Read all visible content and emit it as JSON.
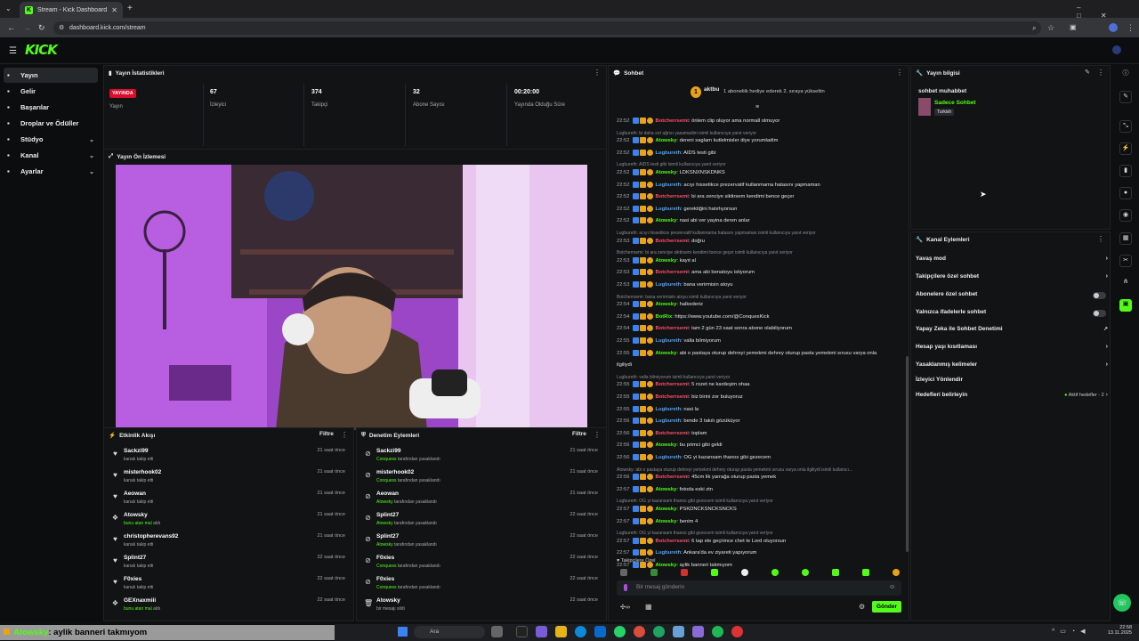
{
  "browser": {
    "tab_title": "Stream - Kick Dashboard",
    "url": "dashboard.kick.com/stream"
  },
  "header": {
    "logo": "KICK"
  },
  "nav": {
    "items": [
      {
        "label": "Yayın",
        "active": true
      },
      {
        "label": "Gelir"
      },
      {
        "label": "Başarılar"
      },
      {
        "label": "Droplar ve Ödüller"
      },
      {
        "label": "Stüdyo",
        "chevron": true
      },
      {
        "label": "Kanal",
        "chevron": true
      },
      {
        "label": "Ayarlar",
        "chevron": true
      }
    ]
  },
  "stats": {
    "title": "Yayın İstatistikleri",
    "live_badge": "YAYINDA",
    "live_label": "Yayın",
    "items": [
      {
        "value": "67",
        "label": "İzleyici"
      },
      {
        "value": "374",
        "label": "Takipçi"
      },
      {
        "value": "32",
        "label": "Abone Sayısı"
      },
      {
        "value": "00:20:00",
        "label": "Yayında Olduğu Süre"
      }
    ]
  },
  "preview": {
    "title": "Yayın Ön İzlemesi"
  },
  "activity": {
    "title": "Etkinlik Akışı",
    "filter": "Filtre",
    "rows": [
      {
        "icon": "heart",
        "name": "Sackzi99",
        "sub": "kanalı takip etti",
        "time": "21 saat önce"
      },
      {
        "icon": "heart",
        "name": "misterhook02",
        "sub": "kanalı takip etti",
        "time": "21 saat önce"
      },
      {
        "icon": "heart",
        "name": "Aeowan",
        "sub": "kanalı takip etti",
        "time": "21 saat önce"
      },
      {
        "icon": "gift",
        "name": "Atowsky",
        "sub_hl": "bunu atan mal",
        "sub": " aldı",
        "time": "21 saat önce"
      },
      {
        "icon": "heart",
        "name": "christopherevans92",
        "sub": "kanalı takip etti",
        "time": "21 saat önce"
      },
      {
        "icon": "heart",
        "name": "Splint27",
        "sub": "kanalı takip etti",
        "time": "22 saat önce"
      },
      {
        "icon": "heart",
        "name": "F0xies",
        "sub": "kanalı takip etti",
        "time": "22 saat önce"
      },
      {
        "icon": "gift",
        "name": "GEXnaxmiii",
        "sub_hl": "bunu atan mal",
        "sub": " aldı",
        "time": "22 saat önce"
      }
    ]
  },
  "moderation": {
    "title": "Denetim Eylemleri",
    "filter": "Filtre",
    "rows": [
      {
        "icon": "ban",
        "name": "Sackzi99",
        "sub_hl": "Conquess",
        "sub": " tarafından yasaklandı",
        "time": "21 saat önce"
      },
      {
        "icon": "ban",
        "name": "misterhook02",
        "sub_hl": "Conquess",
        "sub": " tarafından yasaklandı",
        "time": "21 saat önce"
      },
      {
        "icon": "ban",
        "name": "Aeowan",
        "sub_hl": "Atowsky",
        "sub": " tarafından yasaklandı",
        "time": "21 saat önce"
      },
      {
        "icon": "ban",
        "name": "Splint27",
        "sub_hl": "Atowsky",
        "sub": " tarafından yasaklandı",
        "time": "22 saat önce"
      },
      {
        "icon": "ban",
        "name": "Splint27",
        "sub_hl": "Atowsky",
        "sub": " tarafından yasaklandı",
        "time": "22 saat önce"
      },
      {
        "icon": "ban",
        "name": "F0xies",
        "sub_hl": "Conquess",
        "sub": " tarafından yasaklandı",
        "time": "22 saat önce"
      },
      {
        "icon": "ban",
        "name": "F0xies",
        "sub_hl": "Conquess",
        "sub": " tarafından yasaklandı",
        "time": "22 saat önce"
      },
      {
        "icon": "trash",
        "name": "Atowsky",
        "sub": "bir mesajı sildi",
        "time": "22 saat önce"
      }
    ]
  },
  "chat": {
    "title": "Sohbet",
    "pinned_user": "aktbu",
    "pinned_text": "1 aboneliik hediye ederek 2. sıraya yükseltin",
    "lines": [
      {
        "t": "22:52",
        "u": "Botcherrsemi",
        "c": "#ff4d6d",
        "m": ": önlem clip oluyor ama normall olmuyor"
      },
      {
        "reply": "Lugbureth: bi daha sırt ağrısı yasamadim isimli kullanıcıya yanıt veriyor"
      },
      {
        "t": "22:52",
        "u": "Atowsky",
        "c": "#53fc18",
        "m": ": dereni saglam kutlelmisler diye yorumladim"
      },
      {
        "t": "22:52",
        "u": "Lugbureth",
        "c": "#4da3ff",
        "m": ": AIDS testi gibi"
      },
      {
        "reply": "Lugbureth: AIDS testi gibi isimli kullanıcıya yanıt veriyor"
      },
      {
        "t": "22:52",
        "u": "Atowsky",
        "c": "#53fc18",
        "m": ": LDKSNXNSKDNKS"
      },
      {
        "t": "22:52",
        "u": "Lugbureth",
        "c": "#4da3ff",
        "m": ": acıyı hissetikce prezervatif kullanmama hatasını yapmaman"
      },
      {
        "t": "22:52",
        "u": "Botcherrsemi",
        "c": "#ff4d6d",
        "m": ": bi ara zenciye siktirsem kendimi bence geçer"
      },
      {
        "t": "22:52",
        "u": "Lugbureth",
        "c": "#4da3ff",
        "m": ": gerektiğini hatırlıyorsun"
      },
      {
        "t": "22:52",
        "u": "Atowsky",
        "c": "#53fc18",
        "m": ": nasi abi ver yayina deren anlar"
      },
      {
        "reply": "Lugbureth: acıyı hissetikce prezervatif kullanmama hatasını yapmaman isimli kullanıcıya yanıt veriyor"
      },
      {
        "t": "22:53",
        "u": "Botcherrsemi",
        "c": "#ff4d6d",
        "m": ": doğru"
      },
      {
        "reply": "Botcherrsemi: bi ara zenciye siktirsem kendimi bence geçer isimli kullanıcıya yanıt veriyor"
      },
      {
        "t": "22:53",
        "u": "Atowsky",
        "c": "#53fc18",
        "m": ": kayıt al"
      },
      {
        "t": "22:53",
        "u": "Botcherrsemi",
        "c": "#ff4d6d",
        "m": ": ama abi benatoyu istiyorum"
      },
      {
        "t": "22:53",
        "u": "Lugbureth",
        "c": "#4da3ff",
        "m": ": bana verirmisin atoyu"
      },
      {
        "reply": "Botcherrsemi: bana verirmisin atoyu isimli kullanıcıya yanıt veriyor"
      },
      {
        "t": "22:54",
        "u": "Atowsky",
        "c": "#53fc18",
        "m": ": halkederiz"
      },
      {
        "t": "22:54",
        "u": "BotRix",
        "c": "#53fc18",
        "m": ": https://www.youtube.com/@ConquesKick"
      },
      {
        "t": "22:54",
        "u": "Botcherrsemi",
        "c": "#ff4d6d",
        "m": ": tam 2 gün 23 saat sonra abone olabiliyorum"
      },
      {
        "t": "22:55",
        "u": "Lugbureth",
        "c": "#4da3ff",
        "m": ": valla bilmiyorum"
      },
      {
        "t": "22:55",
        "u": "Atowsky",
        "c": "#53fc18",
        "m": ": abi o pastaya oturup dehreyi yemekmi dehrey oturup pasta yemekmi sırusu varya onla"
      },
      {
        "t": "",
        "u": "",
        "c": "#fff",
        "m": "ilgiliydi"
      },
      {
        "reply": "Lugbureth: valla bilmiyorum isimli kullanıcıya yanıt veriyor"
      },
      {
        "t": "22:55",
        "u": "Botcherrsemi",
        "c": "#ff4d6d",
        "m": ": 5 rozet ne kardeşim ohaa"
      },
      {
        "t": "22:55",
        "u": "Botcherrsemi",
        "c": "#ff4d6d",
        "m": ": biz birini zor buluyoruz"
      },
      {
        "t": "22:55",
        "u": "Lugbureth",
        "c": "#4da3ff",
        "m": ": nasi la"
      },
      {
        "t": "22:56",
        "u": "Lugbureth",
        "c": "#4da3ff",
        "m": ": bende 3 takılı gözüküyor"
      },
      {
        "t": "22:56",
        "u": "Botcherrsemi",
        "c": "#ff4d6d",
        "m": ": toplam"
      },
      {
        "t": "22:56",
        "u": "Atowsky",
        "c": "#53fc18",
        "m": ": bu primci gibi geldi"
      },
      {
        "t": "22:56",
        "u": "Lugbureth",
        "c": "#4da3ff",
        "m": ": OG yi kazansam thanos gibi gezecem"
      },
      {
        "reply": "Atowsky: abi o pastaya oturup dehreyi yemekmi dehrey oturup pasta yemekmi sırusu varya onla ilgiliydi isimli kullanıcı..."
      },
      {
        "t": "22:56",
        "u": "Botcherrsemi",
        "c": "#ff4d6d",
        "m": ": 45cm lik yarrağa oturup pasta yemek"
      },
      {
        "t": "22:57",
        "u": "Atowsky",
        "c": "#53fc18",
        "m": ": fotoda eski ztn"
      },
      {
        "reply": "Lugbureth: OG yi kazansam thanos gibi gezecem isimli kullanıcıya yanıt veriyor"
      },
      {
        "t": "22:57",
        "u": "Atowsky",
        "c": "#53fc18",
        "m": ": PSKDNCKSNCKSNCKS"
      },
      {
        "t": "22:57",
        "u": "Atowsky",
        "c": "#53fc18",
        "m": ": benim 4"
      },
      {
        "reply": "Lugbureth: OG yi kazansam thanos gibi gezecem isimli kullanıcıya yanıt veriyor"
      },
      {
        "t": "22:57",
        "u": "Botcherrsemi",
        "c": "#ff4d6d",
        "m": ": 6 tap ele geçirince chet te Lord oluyorsun"
      },
      {
        "t": "22:57",
        "u": "Lugbureth",
        "c": "#4da3ff",
        "m": ": Ankara'da ev ziyareti yapıyorum"
      },
      {
        "t": "22:57",
        "u": "Atowsky",
        "c": "#53fc18",
        "m": ": aylik banneri takmıyom"
      }
    ],
    "followers_only": "Takipçilere Özel",
    "input_placeholder": "Bir mesaj gönderin",
    "send_label": "Gönder"
  },
  "stream_info": {
    "title": "Yayın bilgisi",
    "stream_title": "sohbet muhabbet",
    "category": "Sadece Sohbet",
    "tag": "Turkish"
  },
  "channel_actions": {
    "title": "Kanal Eylemleri",
    "items": [
      {
        "label": "Yavaş mod",
        "kind": "chevron"
      },
      {
        "label": "Takipçilere özel sohbet",
        "kind": "chevron"
      },
      {
        "label": "Abonelere özel sohbet",
        "kind": "toggle"
      },
      {
        "label": "Yalnızca ifadelerle sohbet",
        "kind": "toggle"
      },
      {
        "label": "Yapay Zeka ile Sohbet Denetimi",
        "kind": "external"
      },
      {
        "label": "Hesap yaşı kısıtlaması",
        "kind": "chevron"
      },
      {
        "label": "Yasaklanmış kelimeler",
        "kind": "chevron"
      },
      {
        "label": "İzleyici Yönlendir",
        "kind": "none"
      },
      {
        "label": "Hedefleri belirleyin",
        "kind": "goals",
        "extra": "Aktif hedefler - 2"
      }
    ]
  },
  "overlay_caption": {
    "user": "Atowsky",
    "text": ": aylik banneri takmıyom"
  },
  "taskbar": {
    "search": "Ara",
    "time": "22:58",
    "date": "13.11.2025"
  },
  "colors": {
    "accent": "#53fc18",
    "live": "#d90d2b",
    "bg": "#0d0f10"
  }
}
